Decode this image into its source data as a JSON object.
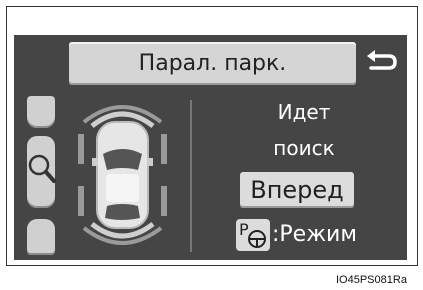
{
  "title": "Парал. парк.",
  "status": {
    "line1": "Идет",
    "line2": "поиск"
  },
  "action_button": "Вперед",
  "mode": {
    "icon_letter": "P",
    "label": ":Режим"
  },
  "image_code": "IO45PS081Ra",
  "colors": {
    "screen_bg": "#454545",
    "button": "#d5d5d5",
    "text_light": "#ffffff"
  },
  "icons": [
    "back-arrow-icon",
    "magnifier-icon",
    "car-top-view-icon",
    "parking-steering-icon"
  ]
}
